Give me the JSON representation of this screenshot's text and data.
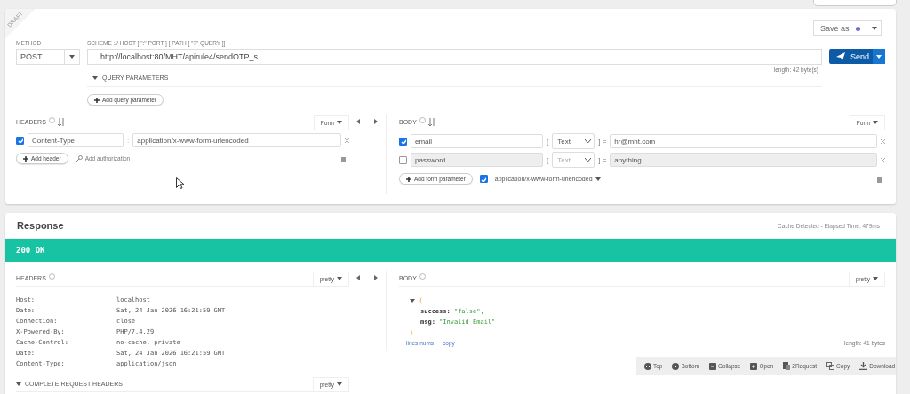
{
  "draft_label": "DRAFT",
  "request": {
    "method_label": "METHOD",
    "method": "POST",
    "url_label": "SCHEME :// HOST [ \":\" PORT ] [ PATH [ \"?\" QUERY ]]",
    "url": "http://localhost:80/MHT/apirule4/sendOTP_s",
    "length": "length: 42 byte(s)",
    "save_as": "Save as",
    "send": "Send",
    "query_parameters": {
      "label": "QUERY PARAMETERS",
      "expanded": true
    },
    "add_query": "Add query parameter"
  },
  "headers": {
    "title": "HEADERS",
    "mode": "Form",
    "add_header": "Add header",
    "add_auth": "Add authorization",
    "rows": [
      {
        "checked": true,
        "name": "Content-Type",
        "separator": ":",
        "value": "application/x-www-form-urlencoded"
      }
    ]
  },
  "body": {
    "title": "BODY",
    "mode": "Form",
    "add_param": "Add form parameter",
    "content_type": {
      "checked": true,
      "label": "application/x-www-form-urlencoded"
    },
    "rows": [
      {
        "checked": true,
        "name": "email",
        "bracket_open": "[",
        "type": "Text",
        "bracket_close": "] =",
        "value": "hr@mht.com"
      },
      {
        "checked": false,
        "name": "password",
        "bracket_open": "[",
        "type": "Text",
        "bracket_close": "] =",
        "value": "anything"
      }
    ]
  },
  "response": {
    "title": "Response",
    "timing": "Cache Detected - Elapsed Time: 479ms",
    "status": "200 OK",
    "headers": {
      "title": "HEADERS",
      "mode": "pretty",
      "rows": [
        {
          "name": "Host:",
          "value": "localhost"
        },
        {
          "name": "Date:",
          "value": "Sat, 24 Jan 2026 16:21:59 GMT"
        },
        {
          "name": "Connection:",
          "value": "close"
        },
        {
          "name": "X-Powered-By:",
          "value": "PHP/7.4.29"
        },
        {
          "name": "Cache-Control:",
          "value": "no-cache, private"
        },
        {
          "name": "Date:",
          "value": "Sat, 24 Jan 2026 16:21:59 GMT"
        },
        {
          "name": "Content-Type:",
          "value": "application/json"
        }
      ]
    },
    "complete_headers": {
      "label": "COMPLETE REQUEST HEADERS",
      "mode": "pretty"
    },
    "body": {
      "title": "BODY",
      "mode": "pretty",
      "open_brace": "{",
      "close_brace": "}",
      "lines_nums": "lines nums",
      "copy": "copy",
      "length": "length: 41 bytes",
      "fields": [
        {
          "key": "success:",
          "value": "\"false\","
        },
        {
          "key": "msg:",
          "value": "\"Invalid Email\""
        }
      ]
    },
    "toolbar": [
      {
        "kind": "up",
        "label": "Top"
      },
      {
        "kind": "down",
        "label": "Bottom"
      },
      {
        "kind": "minus",
        "label": "Collapse"
      },
      {
        "kind": "plus",
        "label": "Open"
      },
      {
        "kind": "clip",
        "label": "2Request"
      },
      {
        "kind": "copy",
        "label": "Copy"
      },
      {
        "kind": "download",
        "label": "Download"
      }
    ]
  }
}
